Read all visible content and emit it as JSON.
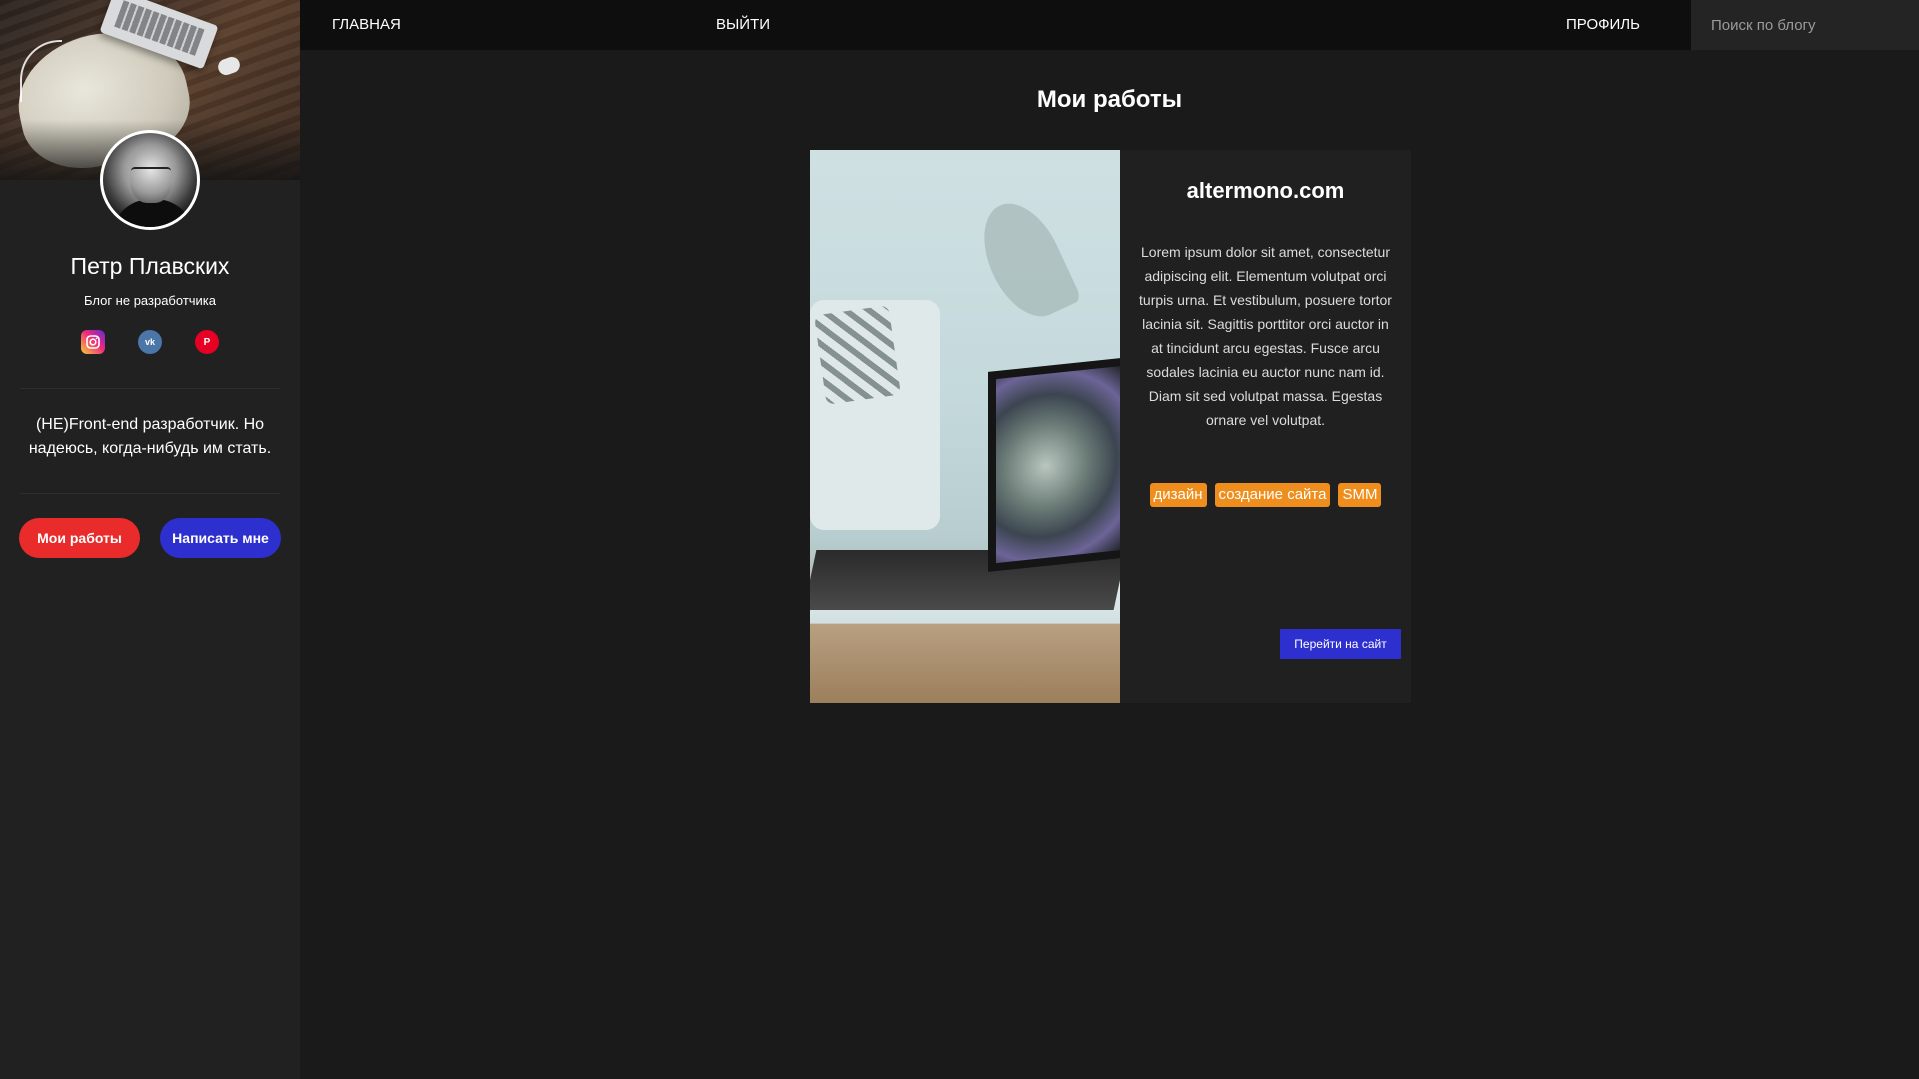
{
  "nav": {
    "home": "ГЛАВНАЯ",
    "logout": "ВЫЙТИ",
    "profile": "ПРОФИЛЬ",
    "search_placeholder": "Поиск по блогу"
  },
  "profile": {
    "name": "Петр Плавских",
    "tagline": "Блог не разработчика",
    "about": "(НЕ)Front-end разработчик. Но надеюсь, когда-нибудь им стать.",
    "socials": [
      {
        "name": "instagram-icon",
        "glyph": "◎"
      },
      {
        "name": "vk-icon",
        "glyph": "vk"
      },
      {
        "name": "pinterest-icon",
        "glyph": "P"
      }
    ],
    "buttons": {
      "works": "Мои работы",
      "write": "Написать мне"
    }
  },
  "main": {
    "title": "Мои работы",
    "card": {
      "title": "altermono.com",
      "description": "Lorem ipsum dolor sit amet, consectetur adipiscing elit. Elementum volutpat orci turpis urna. Et vestibulum, posuere tortor lacinia sit. Sagittis porttitor orci auctor in at tincidunt arcu egestas. Fusce arcu sodales lacinia eu auctor nunc nam id. Diam sit sed volutpat massa. Egestas ornare vel volutpat.",
      "tags": [
        "дизайн",
        "создание сайта",
        "SMM"
      ],
      "button": "Перейти на сайт"
    }
  },
  "colors": {
    "background": "#1a1a1a",
    "sidebar": "#212121",
    "topbar": "#0e0e0e",
    "accent_red": "#ea2b2b",
    "accent_blue": "#2e2fcf",
    "tag": "#ef8e1c"
  }
}
